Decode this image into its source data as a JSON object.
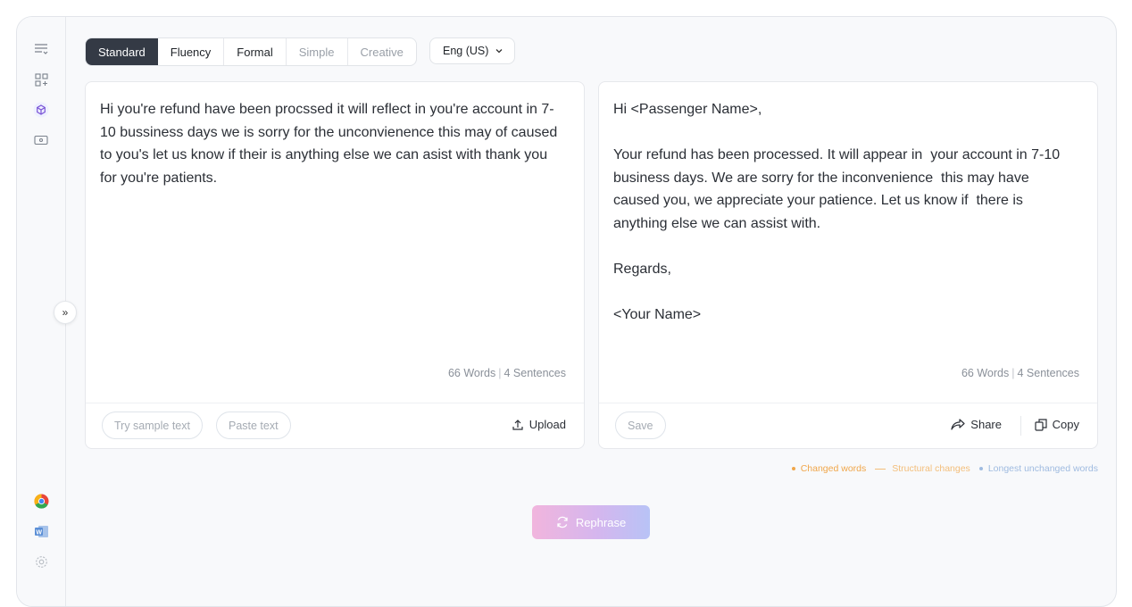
{
  "toolbar": {
    "modes": [
      "Standard",
      "Fluency",
      "Formal",
      "Simple",
      "Creative"
    ],
    "language": "Eng (US)"
  },
  "input": {
    "text": "Hi you're refund have been procssed it will reflect in you're account in 7-10 bussiness days we is sorry for the unconvienence this may of caused to you's let us know if their is anything else we can asist with thank you for you're patients.",
    "words": "66 Words",
    "sentences": "4 Sentences",
    "try_sample_label": "Try sample text",
    "paste_label": "Paste text",
    "upload_label": "Upload"
  },
  "output": {
    "text": "Hi <Passenger Name>,\n\nYour refund has been processed. It will appear in  your account in 7-10 business days. We are sorry for the inconvenience  this may have caused you, we appreciate your patience. Let us know if  there is anything else we can assist with.\n\nRegards,\n\n<Your Name>",
    "words": "66 Words",
    "sentences": "4 Sentences",
    "save_label": "Save",
    "share_label": "Share",
    "copy_label": "Copy"
  },
  "legend": {
    "changed": "Changed words",
    "structural": "Structural changes",
    "unchanged": "Longest unchanged words"
  },
  "rephrase_label": "Rephrase",
  "colors": {
    "changed": "#f0a64a",
    "structural": "#f3be7a",
    "unchanged": "#9fbbe0",
    "active_mode": "#343a45"
  }
}
